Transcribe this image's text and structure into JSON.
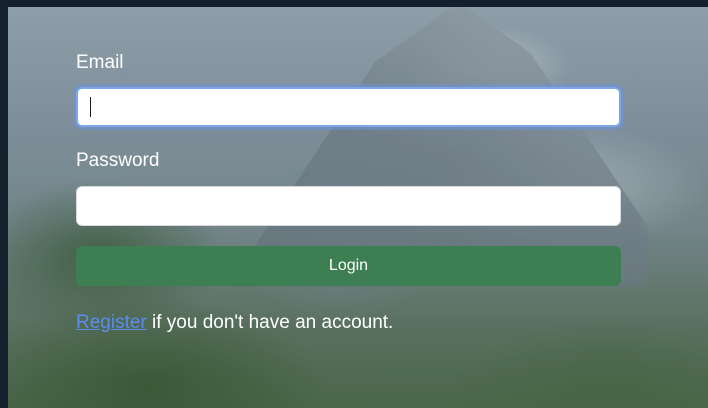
{
  "form": {
    "email_label": "Email",
    "email_value": "",
    "password_label": "Password",
    "password_value": "",
    "login_button": "Login",
    "register_link": "Register",
    "register_suffix": " if you don't have an account."
  },
  "colors": {
    "login_button": "#3d7e52",
    "link": "#5b8def",
    "focus_ring": "#7ea6e8"
  }
}
